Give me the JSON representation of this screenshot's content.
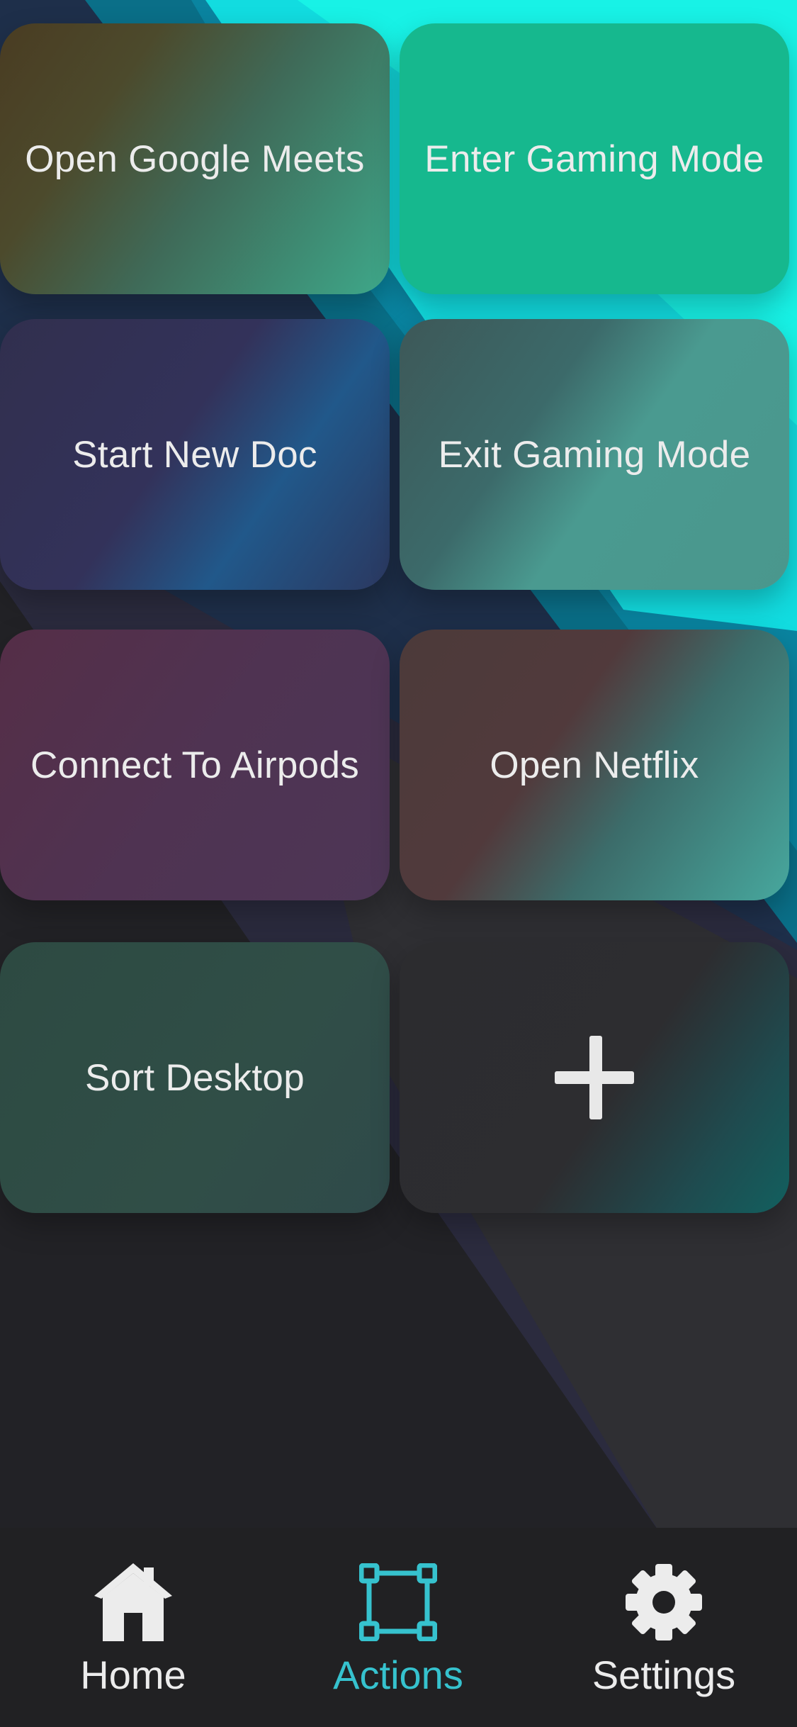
{
  "tiles": [
    {
      "id": "open-google-meets",
      "label": "Open Google Meets"
    },
    {
      "id": "enter-gaming-mode",
      "label": "Enter Gaming Mode"
    },
    {
      "id": "start-new-doc",
      "label": "Start New Doc"
    },
    {
      "id": "exit-gaming-mode",
      "label": "Exit Gaming Mode"
    },
    {
      "id": "connect-to-airpods",
      "label": "Connect To Airpods"
    },
    {
      "id": "open-netflix",
      "label": "Open Netflix"
    },
    {
      "id": "sort-desktop",
      "label": "Sort Desktop"
    }
  ],
  "add_tile": {
    "icon": "plus-icon"
  },
  "bottom_nav": {
    "items": [
      {
        "label": "Home",
        "icon": "home-icon",
        "active": false
      },
      {
        "label": "Actions",
        "icon": "actions-icon",
        "active": true
      },
      {
        "label": "Settings",
        "icon": "gear-icon",
        "active": false
      }
    ]
  },
  "colors": {
    "background_dark": "#222226",
    "accent_cyan": "#14f0e4",
    "tile_green": "#16b88e",
    "nav_background": "#212123",
    "nav_active": "#36c2ce",
    "text_light": "#ececec"
  }
}
